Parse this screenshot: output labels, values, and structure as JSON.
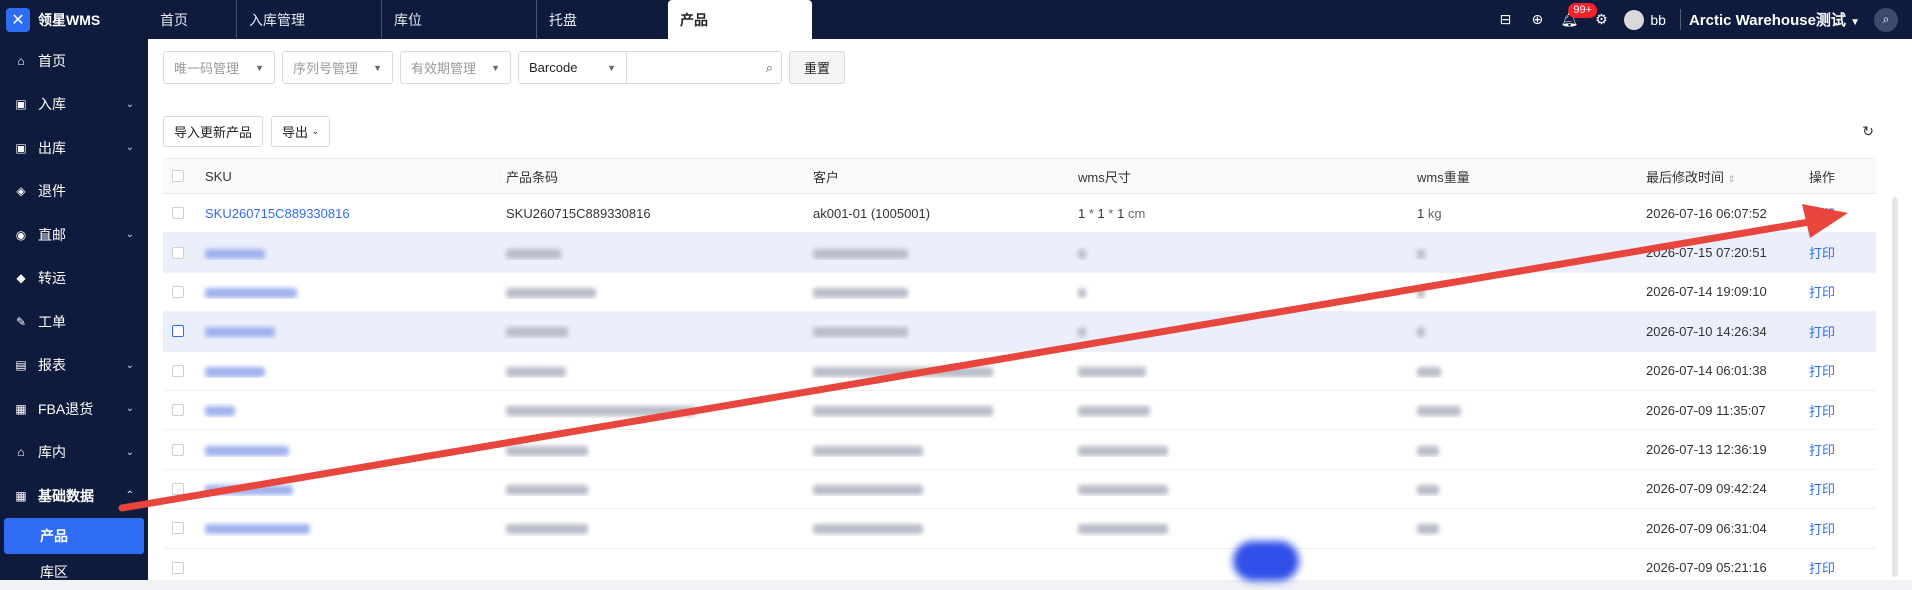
{
  "topbar": {
    "logo_text": "领星WMS",
    "tabs": [
      "首页",
      "入库管理",
      "库位",
      "托盘",
      "产品"
    ],
    "active_tab": "产品",
    "notifications_badge": "99+",
    "user_name": "bb",
    "warehouse": "Arctic Warehouse测试"
  },
  "sidebar": {
    "items": [
      {
        "label": "首页",
        "icon": "home-icon"
      },
      {
        "label": "入库",
        "icon": "inbound-icon"
      },
      {
        "label": "出库",
        "icon": "outbound-icon"
      },
      {
        "label": "退件",
        "icon": "return-icon"
      },
      {
        "label": "直邮",
        "icon": "mail-icon"
      },
      {
        "label": "转运",
        "icon": "transfer-icon"
      },
      {
        "label": "工单",
        "icon": "workorder-icon"
      },
      {
        "label": "报表",
        "icon": "report-icon"
      },
      {
        "label": "FBA退货",
        "icon": "fba-icon"
      },
      {
        "label": "库内",
        "icon": "warehouse-icon"
      },
      {
        "label": "基础数据",
        "icon": "data-icon"
      }
    ],
    "sub_items": [
      "产品",
      "库区"
    ]
  },
  "filters": {
    "f1": "唯一码管理",
    "f2": "序列号管理",
    "f3": "有效期管理",
    "barcode": "Barcode",
    "reset": "重置"
  },
  "actions": {
    "import": "导入更新产品",
    "export": "导出"
  },
  "table": {
    "headers": {
      "sku": "SKU",
      "barcode": "产品条码",
      "customer": "客户",
      "size": "wms尺寸",
      "weight": "wms重量",
      "modified": "最后修改时间",
      "ops": "操作"
    },
    "first_row": {
      "sku": "SKU260715C889330816",
      "barcode": "SKU260715C889330816",
      "customer": "ak001-01 (1005001)",
      "size_a": "1",
      "size_b": "1",
      "size_c": "1",
      "size_unit": "cm",
      "weight": "1",
      "weight_unit": "kg",
      "modified": "2026-07-16 06:07:52",
      "op": "打印"
    },
    "timestamps": [
      "2026-07-15 07:20:51",
      "2026-07-14 19:09:10",
      "2026-07-10 14:26:34",
      "2026-07-14 06:01:38",
      "2026-07-09 11:35:07",
      "2026-07-13 12:36:19",
      "2026-07-09 09:42:24",
      "2026-07-09 06:31:04",
      "2026-07-09 05:21:16"
    ],
    "op_label": "打印"
  },
  "colors": {
    "topbar_bg": "#0f1b3d",
    "accent": "#2f6cf6",
    "arrow": "#e8453c"
  }
}
